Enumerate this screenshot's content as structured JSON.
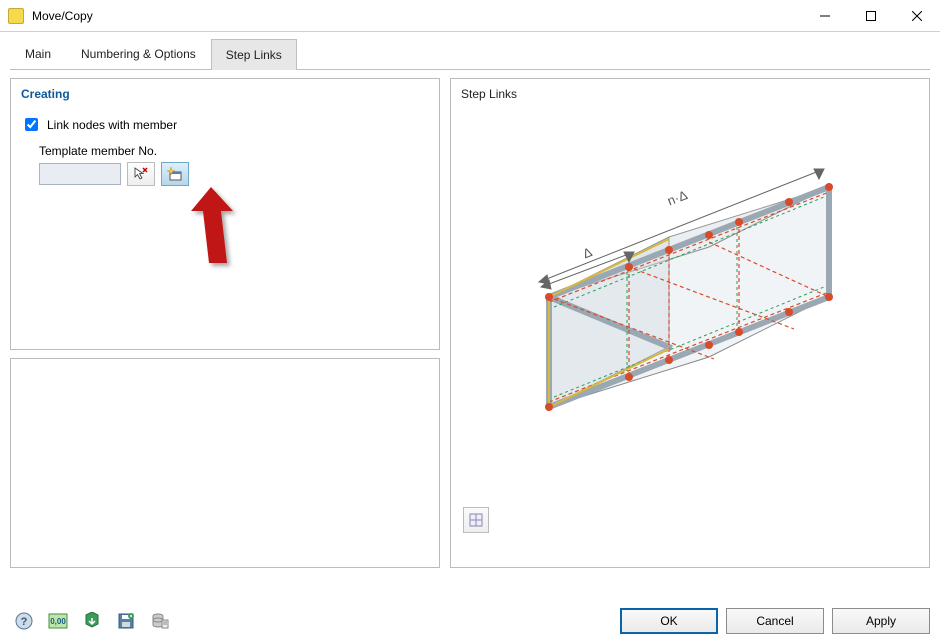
{
  "window": {
    "title": "Move/Copy"
  },
  "tabs": [
    {
      "label": "Main",
      "active": false
    },
    {
      "label": "Numbering & Options",
      "active": false
    },
    {
      "label": "Step Links",
      "active": true
    }
  ],
  "creating": {
    "header": "Creating",
    "checkbox_label": "Link nodes with member",
    "checkbox_checked": true,
    "template_label": "Template member No.",
    "template_value": ""
  },
  "right": {
    "header": "Step Links",
    "label_n_delta": "n·Δ",
    "label_delta": "Δ"
  },
  "buttons": {
    "ok": "OK",
    "cancel": "Cancel",
    "apply": "Apply"
  }
}
